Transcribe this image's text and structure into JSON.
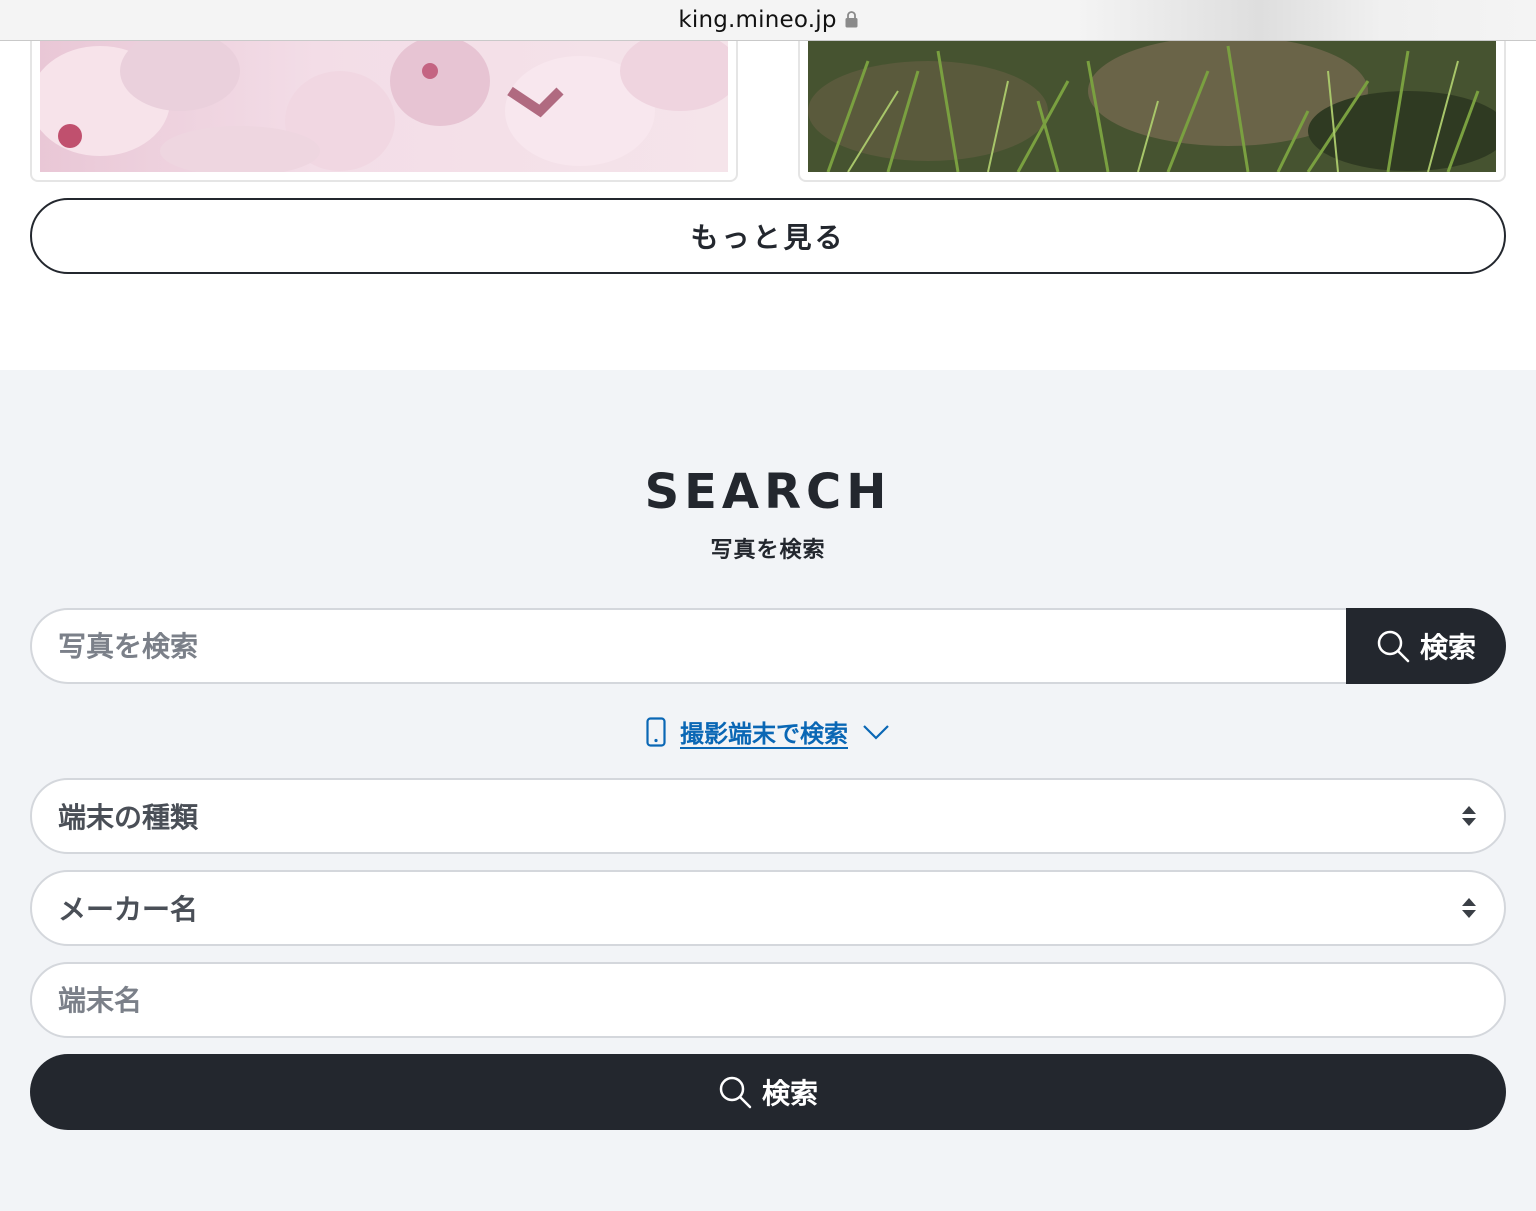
{
  "browser": {
    "url": "king.mineo.jp"
  },
  "gallery": {
    "photos": [
      {
        "alt": "cherry-blossom-photo"
      },
      {
        "alt": "grass-photo"
      }
    ],
    "more_label": "もっと見る"
  },
  "search": {
    "title": "SEARCH",
    "subtitle": "写真を検索",
    "keyword_placeholder": "写真を検索",
    "search_button_label": "検索",
    "device_toggle_label": "撮影端末で検索",
    "device_type_select": "端末の種類",
    "maker_select": "メーカー名",
    "device_name_placeholder": "端末名",
    "device_search_button_label": "検索"
  },
  "colors": {
    "dark": "#23272e",
    "link": "#0a67b5",
    "section_bg": "#f2f4f7"
  }
}
